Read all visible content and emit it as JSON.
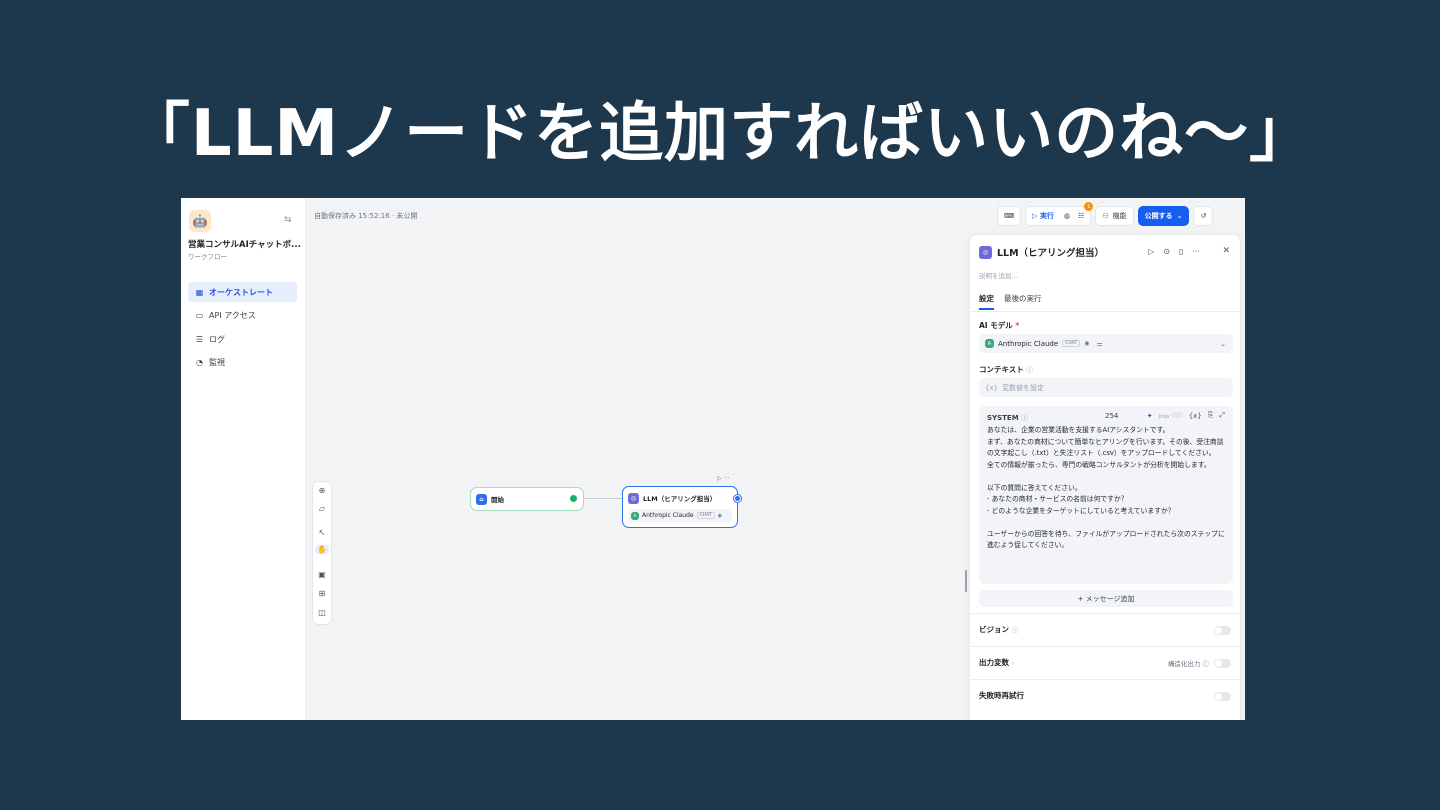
{
  "headline": "「LLMノードを追加すればいいのね〜」",
  "sidebar": {
    "app_name": "営業コンサルAIチャットボ...",
    "app_type": "ワークフロー",
    "items": [
      {
        "label": "オーケストレート",
        "icon": "orchestrate-icon"
      },
      {
        "label": "API アクセス",
        "icon": "terminal-icon"
      },
      {
        "label": "ログ",
        "icon": "log-icon"
      },
      {
        "label": "監視",
        "icon": "monitor-icon"
      }
    ]
  },
  "canvas": {
    "autosave": "自動保存済み 15:52:16 · 未公開",
    "run_label": "実行",
    "badge_count": "1",
    "features_label": "機能",
    "publish_label": "公開する"
  },
  "nodes": {
    "start": {
      "title": "開始"
    },
    "llm": {
      "title": "LLM（ヒアリング担当）",
      "model": "Anthropic Claude",
      "model_tag": "CHAT"
    }
  },
  "panel": {
    "title": "LLM（ヒアリング担当）",
    "description_placeholder": "説明を追加...",
    "tabs": [
      "設定",
      "最後の実行"
    ],
    "ai_model_label": "AI モデル",
    "model_name": "Anthropic Claude",
    "model_tag": "CHAT",
    "context_label": "コンテキスト",
    "context_placeholder": "変数値を設定",
    "context_prefix": "{x}",
    "system_label": "SYSTEM",
    "system_count": "254",
    "system_var_token": "{x}",
    "system_text": "あなたは、企業の営業活動を支援するAIアシスタントです。\nまず、あなたの商材について簡単なヒアリングを行います。その後、受注商談の文字起こし（.txt）と失注リスト（.csv）をアップロードしてください。\n全ての情報が揃ったら、専門の戦略コンサルタントが分析を開始します。\n\n以下の質問に答えてください。\n- あなたの商材・サービスの名前は何ですか？\n- どのような企業をターゲットにしていると考えていますか？\n\nユーザーからの回答を待ち、ファイルがアップロードされたら次のステップに進むよう促してください。",
    "add_message_label": "+ メッセージ追加",
    "vision_label": "ビジョン",
    "output_vars_label": "出力変数",
    "structured_output_label": "構造化出力",
    "retry_label": "失敗時再試行"
  },
  "colors": {
    "background": "#1d374d",
    "accent": "#155eef",
    "start_border": "#a7dbc0",
    "success": "#17b26a"
  }
}
